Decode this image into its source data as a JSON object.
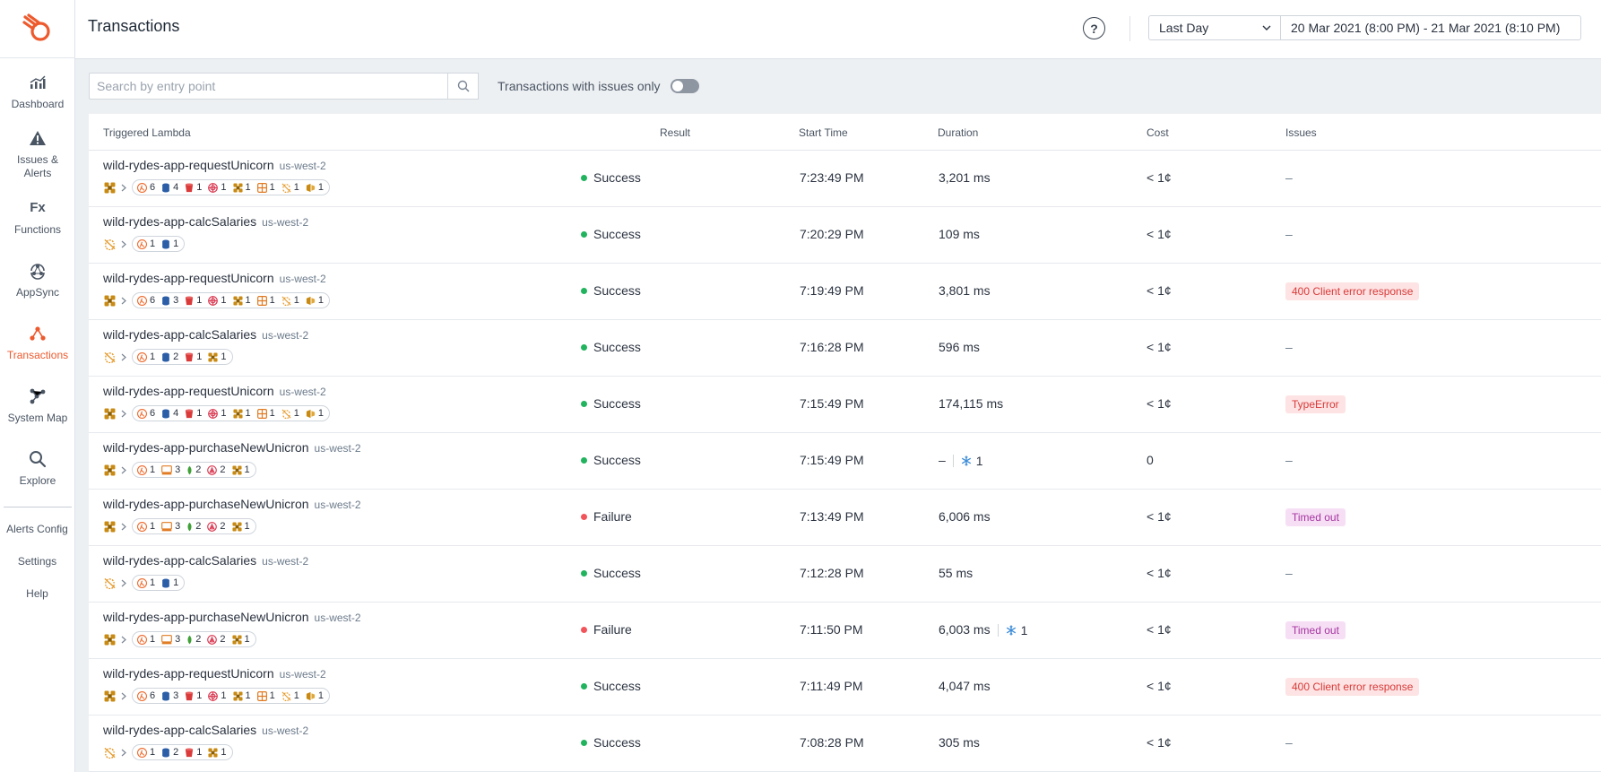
{
  "app": {
    "title": "Transactions",
    "brand_color": "#ed5a2e"
  },
  "sidebar": {
    "items": [
      {
        "label": "Dashboard",
        "icon": "dashboard-icon"
      },
      {
        "label": "Issues & Alerts",
        "icon": "alert-triangle-icon"
      },
      {
        "label": "Functions",
        "icon": "fx-icon"
      },
      {
        "label": "AppSync",
        "icon": "appsync-icon"
      },
      {
        "label": "Transactions",
        "icon": "transactions-icon",
        "active": true
      },
      {
        "label": "System Map",
        "icon": "system-map-icon"
      },
      {
        "label": "Explore",
        "icon": "search-icon"
      }
    ],
    "links": [
      "Alerts Config",
      "Settings",
      "Help"
    ]
  },
  "header": {
    "help_label": "?",
    "range_label": "Last Day",
    "date_range": "20 Mar 2021 (8:00 PM) - 21 Mar 2021 (8:10 PM)"
  },
  "filters": {
    "search_placeholder": "Search by entry point",
    "toggle_label": "Transactions with issues only",
    "toggle_on": false
  },
  "table": {
    "columns": [
      "Triggered Lambda",
      "Result",
      "Start Time",
      "Duration",
      "Cost",
      "Issues"
    ],
    "rows": [
      {
        "lambda": "wild-rydes-app-requestUnicorn",
        "region": "us-west-2",
        "root": "lambda-cluster-icon",
        "services": [
          [
            "lambda",
            "6"
          ],
          [
            "dynamodb",
            "4"
          ],
          [
            "s3",
            "1"
          ],
          [
            "sns",
            "1"
          ],
          [
            "lambda-cluster",
            "1"
          ],
          [
            "api",
            "1"
          ],
          [
            "step",
            "1"
          ],
          [
            "kinesis",
            "1"
          ]
        ],
        "result": "Success",
        "status": "ok",
        "start": "7:23:49 PM",
        "duration": "3,201 ms",
        "cold": "",
        "cost": "< 1¢",
        "issue": "–",
        "issue_type": ""
      },
      {
        "lambda": "wild-rydes-app-calcSalaries",
        "region": "us-west-2",
        "root": "schedule-icon",
        "services": [
          [
            "lambda",
            "1"
          ],
          [
            "dynamodb",
            "1"
          ]
        ],
        "result": "Success",
        "status": "ok",
        "start": "7:20:29 PM",
        "duration": "109 ms",
        "cold": "",
        "cost": "< 1¢",
        "issue": "–",
        "issue_type": ""
      },
      {
        "lambda": "wild-rydes-app-requestUnicorn",
        "region": "us-west-2",
        "root": "lambda-cluster-icon",
        "services": [
          [
            "lambda",
            "6"
          ],
          [
            "dynamodb",
            "3"
          ],
          [
            "s3",
            "1"
          ],
          [
            "sns",
            "1"
          ],
          [
            "lambda-cluster",
            "1"
          ],
          [
            "api",
            "1"
          ],
          [
            "step",
            "1"
          ],
          [
            "kinesis",
            "1"
          ]
        ],
        "result": "Success",
        "status": "ok",
        "start": "7:19:49 PM",
        "duration": "3,801 ms",
        "cold": "",
        "cost": "< 1¢",
        "issue": "400 Client error response",
        "issue_type": "client"
      },
      {
        "lambda": "wild-rydes-app-calcSalaries",
        "region": "us-west-2",
        "root": "schedule-icon",
        "services": [
          [
            "lambda",
            "1"
          ],
          [
            "dynamodb",
            "2"
          ],
          [
            "s3",
            "1"
          ],
          [
            "lambda-cluster",
            "1"
          ]
        ],
        "result": "Success",
        "status": "ok",
        "start": "7:16:28 PM",
        "duration": "596 ms",
        "cold": "",
        "cost": "< 1¢",
        "issue": "–",
        "issue_type": ""
      },
      {
        "lambda": "wild-rydes-app-requestUnicorn",
        "region": "us-west-2",
        "root": "lambda-cluster-icon",
        "services": [
          [
            "lambda",
            "6"
          ],
          [
            "dynamodb",
            "4"
          ],
          [
            "s3",
            "1"
          ],
          [
            "sns",
            "1"
          ],
          [
            "lambda-cluster",
            "1"
          ],
          [
            "api",
            "1"
          ],
          [
            "step",
            "1"
          ],
          [
            "kinesis",
            "1"
          ]
        ],
        "result": "Success",
        "status": "ok",
        "start": "7:15:49 PM",
        "duration": "174,115 ms",
        "cold": "",
        "cost": "< 1¢",
        "issue": "TypeError",
        "issue_type": "type"
      },
      {
        "lambda": "wild-rydes-app-purchaseNewUnicron",
        "region": "us-west-2",
        "root": "lambda-cluster-icon",
        "services": [
          [
            "lambda",
            "1"
          ],
          [
            "queue",
            "3"
          ],
          [
            "mongo",
            "2"
          ],
          [
            "graphql",
            "2"
          ],
          [
            "lambda-cluster",
            "1"
          ]
        ],
        "result": "Success",
        "status": "ok",
        "start": "7:15:49 PM",
        "duration": "–",
        "cold": "1",
        "cost": "0",
        "issue": "–",
        "issue_type": ""
      },
      {
        "lambda": "wild-rydes-app-purchaseNewUnicron",
        "region": "us-west-2",
        "root": "lambda-cluster-icon",
        "services": [
          [
            "lambda",
            "1"
          ],
          [
            "queue",
            "3"
          ],
          [
            "mongo",
            "2"
          ],
          [
            "graphql",
            "2"
          ],
          [
            "lambda-cluster",
            "1"
          ]
        ],
        "result": "Failure",
        "status": "fail",
        "start": "7:13:49 PM",
        "duration": "6,006 ms",
        "cold": "",
        "cost": "< 1¢",
        "issue": "Timed out",
        "issue_type": "timeout"
      },
      {
        "lambda": "wild-rydes-app-calcSalaries",
        "region": "us-west-2",
        "root": "schedule-icon",
        "services": [
          [
            "lambda",
            "1"
          ],
          [
            "dynamodb",
            "1"
          ]
        ],
        "result": "Success",
        "status": "ok",
        "start": "7:12:28 PM",
        "duration": "55 ms",
        "cold": "",
        "cost": "< 1¢",
        "issue": "–",
        "issue_type": ""
      },
      {
        "lambda": "wild-rydes-app-purchaseNewUnicron",
        "region": "us-west-2",
        "root": "lambda-cluster-icon",
        "services": [
          [
            "lambda",
            "1"
          ],
          [
            "queue",
            "3"
          ],
          [
            "mongo",
            "2"
          ],
          [
            "graphql",
            "2"
          ],
          [
            "lambda-cluster",
            "1"
          ]
        ],
        "result": "Failure",
        "status": "fail",
        "start": "7:11:50 PM",
        "duration": "6,003 ms",
        "cold": "1",
        "cost": "< 1¢",
        "issue": "Timed out",
        "issue_type": "timeout"
      },
      {
        "lambda": "wild-rydes-app-requestUnicorn",
        "region": "us-west-2",
        "root": "lambda-cluster-icon",
        "services": [
          [
            "lambda",
            "6"
          ],
          [
            "dynamodb",
            "3"
          ],
          [
            "s3",
            "1"
          ],
          [
            "sns",
            "1"
          ],
          [
            "lambda-cluster",
            "1"
          ],
          [
            "api",
            "1"
          ],
          [
            "step",
            "1"
          ],
          [
            "kinesis",
            "1"
          ]
        ],
        "result": "Success",
        "status": "ok",
        "start": "7:11:49 PM",
        "duration": "4,047 ms",
        "cold": "",
        "cost": "< 1¢",
        "issue": "400 Client error response",
        "issue_type": "client"
      },
      {
        "lambda": "wild-rydes-app-calcSalaries",
        "region": "us-west-2",
        "root": "schedule-icon",
        "services": [
          [
            "lambda",
            "1"
          ],
          [
            "dynamodb",
            "2"
          ],
          [
            "s3",
            "1"
          ],
          [
            "lambda-cluster",
            "1"
          ]
        ],
        "result": "Success",
        "status": "ok",
        "start": "7:08:28 PM",
        "duration": "305 ms",
        "cold": "",
        "cost": "< 1¢",
        "issue": "–",
        "issue_type": ""
      }
    ]
  }
}
